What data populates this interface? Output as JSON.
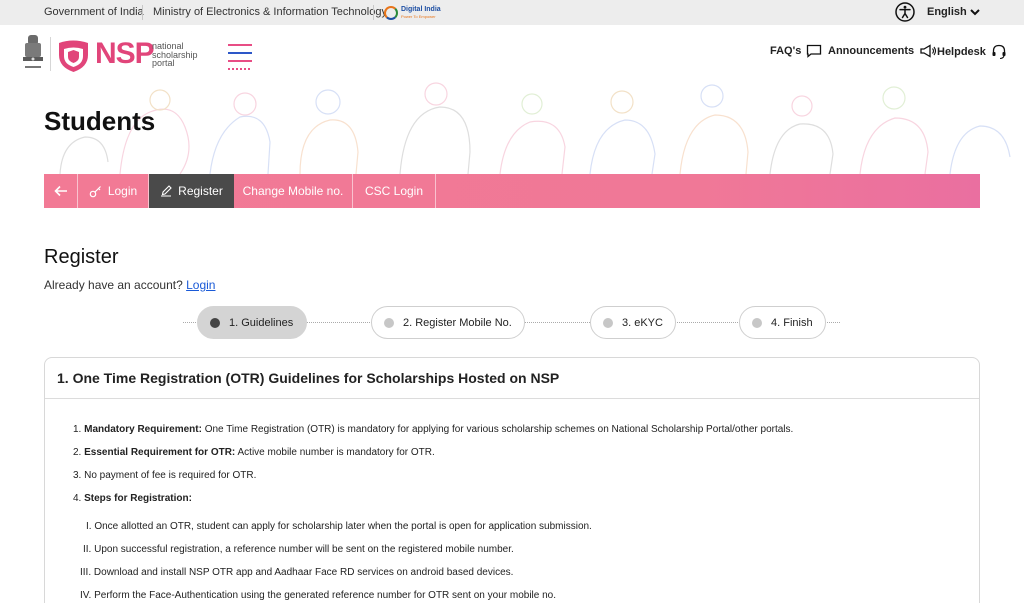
{
  "topbar": {
    "gov": "Government of India",
    "ministry": "Ministry of Electronics & Information Technology",
    "digital_india": "Digital India",
    "digital_india_tag": "Power To Empower",
    "language": "English",
    "icons": [
      "accessibility-icon",
      "chevron-down-icon"
    ]
  },
  "header": {
    "emblem_caption": "सत्यमेव जयते",
    "logo_word": "NSP",
    "logo_sub": [
      "national",
      "scholarship",
      "portal"
    ],
    "nav": [
      {
        "label": "FAQ's",
        "icon": "chat-icon"
      },
      {
        "label": "Announcements",
        "icon": "megaphone-icon"
      },
      {
        "label": "Helpdesk",
        "icon": "headset-icon"
      }
    ]
  },
  "hero": {
    "title": "Students"
  },
  "tabs": {
    "back_icon": "arrow-left-icon",
    "items": [
      {
        "label": "Login",
        "icon": "key-icon"
      },
      {
        "label": "Register",
        "icon": "edit-icon",
        "active": true
      },
      {
        "label": "Change Mobile no."
      },
      {
        "label": "CSC Login"
      }
    ]
  },
  "register": {
    "title": "Register",
    "already_text": "Already have an account?",
    "login_link": "Login"
  },
  "steps": [
    {
      "label": "1. Guidelines",
      "active": true
    },
    {
      "label": "2. Register Mobile No.",
      "active": false
    },
    {
      "label": "3. eKYC",
      "active": false
    },
    {
      "label": "4. Finish",
      "active": false
    }
  ],
  "guidelines": {
    "title": "1. One Time Registration (OTR) Guidelines for Scholarships Hosted on NSP",
    "items": [
      {
        "num": "1.",
        "bold": "Mandatory Requirement:",
        "text": " One Time Registration (OTR) is mandatory for applying for various scholarship schemes on National Scholarship Portal/other portals."
      },
      {
        "num": "2.",
        "bold": "Essential Requirement for OTR:",
        "text": " Active mobile number is mandatory for OTR."
      },
      {
        "num": "3.",
        "bold": "",
        "text": "No payment of fee is required for OTR."
      },
      {
        "num": "4.",
        "bold": "Steps for Registration:",
        "text": ""
      }
    ],
    "sub_items": [
      {
        "num": "I.",
        "text": "Once allotted an OTR, student can apply for scholarship later when the portal is open for application submission."
      },
      {
        "num": "II.",
        "text": "Upon successful registration, a reference number will be sent on the registered mobile number."
      },
      {
        "num": "III.",
        "text": "Download and install NSP OTR app and Aadhaar Face RD services on android based devices."
      },
      {
        "num": "IV.",
        "text": "Perform the Face-Authentication using the generated reference number for OTR sent on your mobile no."
      }
    ]
  }
}
